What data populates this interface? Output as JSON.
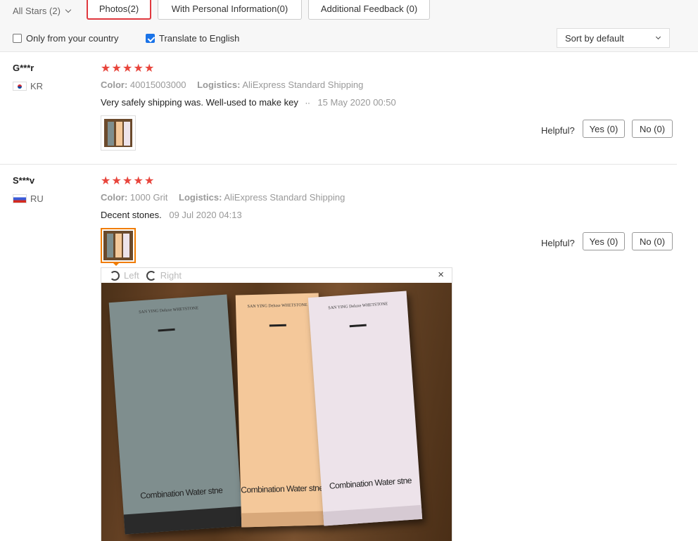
{
  "filters": {
    "star_select": "All Stars (2)",
    "tabs": [
      {
        "label": "Photos(2)",
        "active": true
      },
      {
        "label": "With Personal Information(0)",
        "active": false
      },
      {
        "label": "Additional Feedback (0)",
        "active": false
      }
    ],
    "only_country": {
      "label": "Only from your country",
      "checked": false
    },
    "translate": {
      "label": "Translate to English",
      "checked": true
    },
    "sort": "Sort by default"
  },
  "reviews": [
    {
      "user": "G***r",
      "country": "KR",
      "rating": 5,
      "color_label": "Color:",
      "color_value": "40015003000",
      "logistics_label": "Logistics:",
      "logistics_value": "AliExpress Standard Shipping",
      "text": "Very safely shipping was. Well-used to make key",
      "more": "··",
      "date": "15 May 2020 00:50",
      "helpful_label": "Helpful?",
      "yes": "Yes (0)",
      "no": "No (0)"
    },
    {
      "user": "S***v",
      "country": "RU",
      "rating": 5,
      "color_label": "Color:",
      "color_value": "1000 Grit",
      "logistics_label": "Logistics:",
      "logistics_value": "AliExpress Standard Shipping",
      "text": "Decent stones.",
      "date": "09 Jul 2020 04:13",
      "helpful_label": "Helpful?",
      "yes": "Yes (0)",
      "no": "No (0)"
    }
  ],
  "viewer": {
    "rotate_left": "Left",
    "rotate_right": "Right",
    "close": "×",
    "stone_heading": "SAN YING Deluxe WHETSTONE",
    "stone_label": "Combination Water stne"
  },
  "colors": {
    "accent_red": "#e0383e",
    "star_red": "#e8453c",
    "active_thumb": "#f07c00",
    "checkbox_blue": "#1a73e8"
  }
}
